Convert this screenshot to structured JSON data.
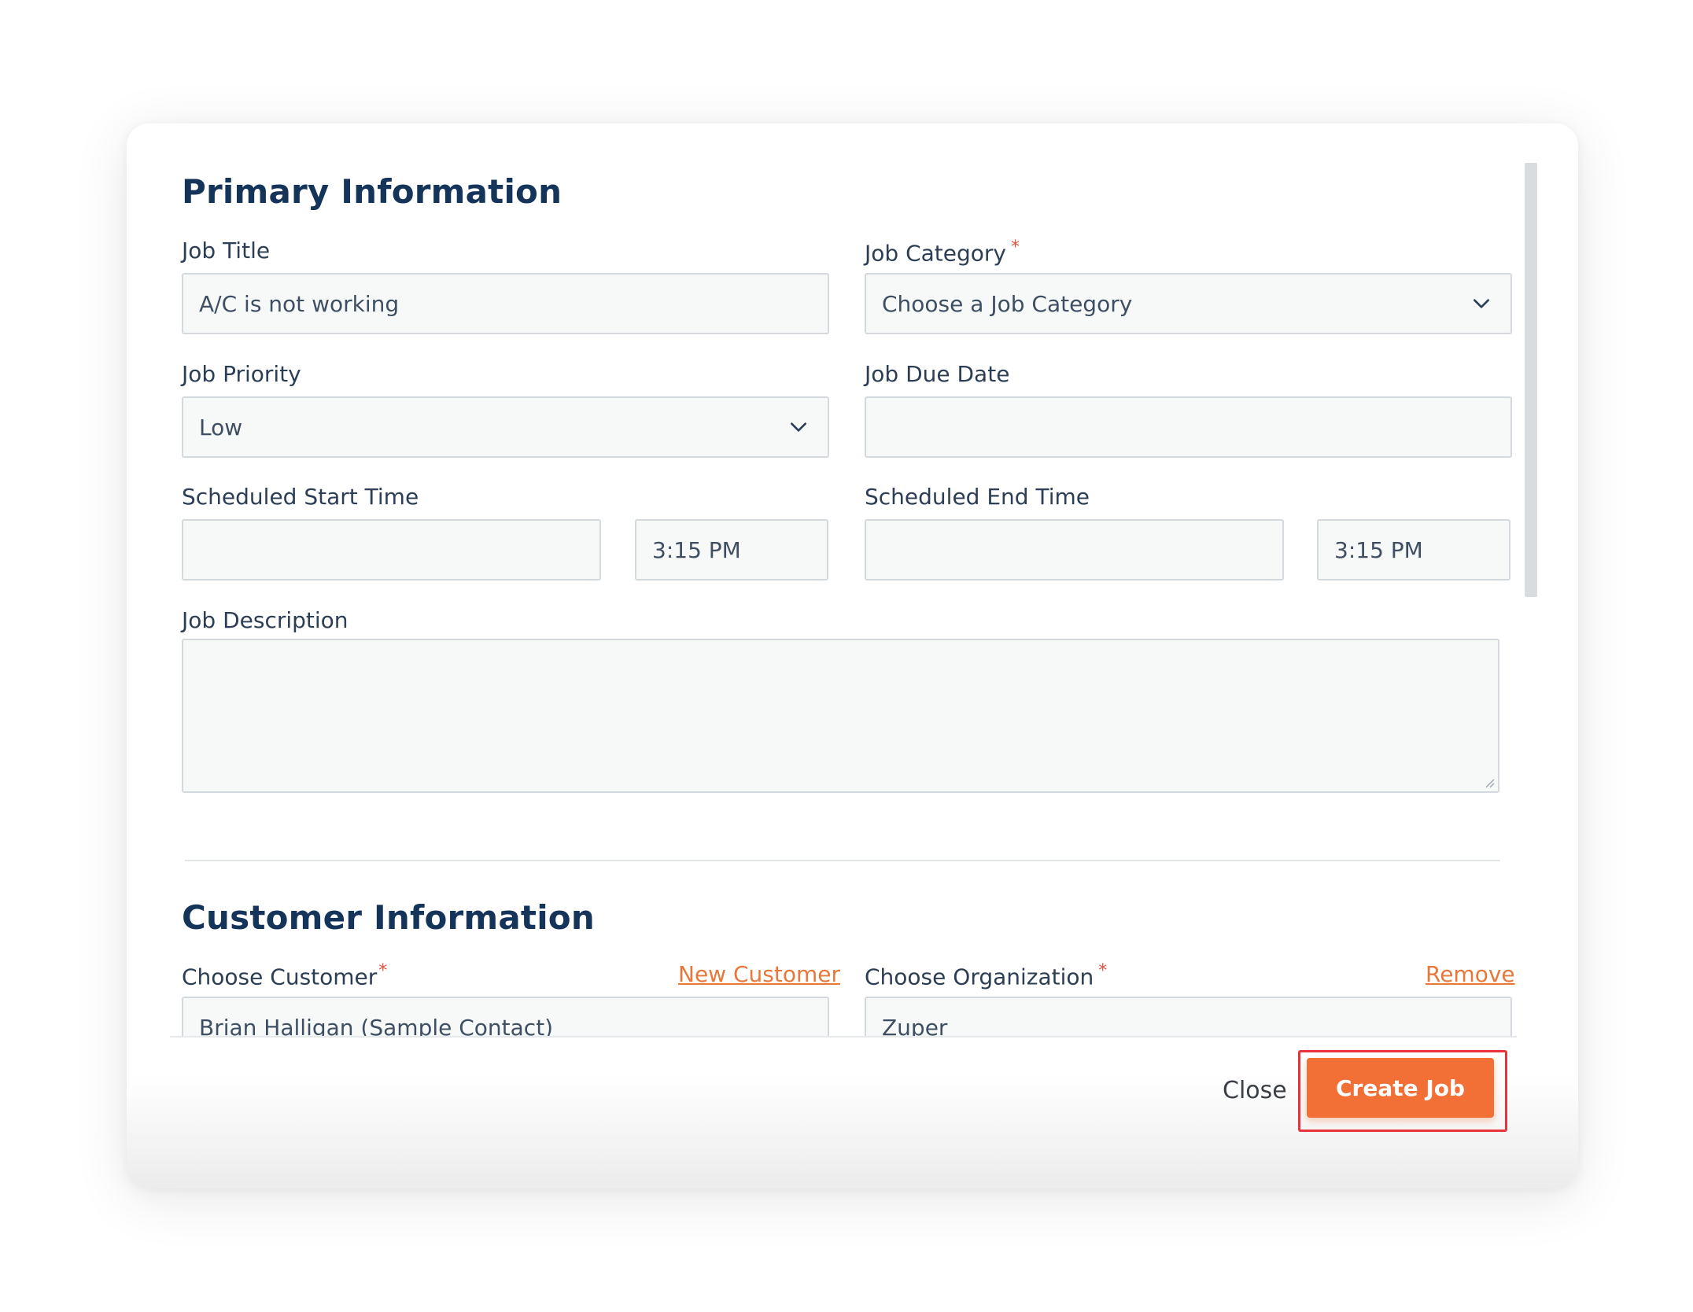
{
  "primary": {
    "title": "Primary Information",
    "job_title": {
      "label": "Job Title",
      "value": "A/C is not working"
    },
    "job_category": {
      "label": "Job Category",
      "required_mark": "*",
      "value": "Choose a Job Category",
      "icon": "chevron-down-icon"
    },
    "job_priority": {
      "label": "Job Priority",
      "value": "Low",
      "icon": "chevron-down-icon"
    },
    "job_due_date": {
      "label": "Job Due Date",
      "value": ""
    },
    "scheduled_start": {
      "label": "Scheduled Start Time",
      "date": "",
      "time": "3:15 PM"
    },
    "scheduled_end": {
      "label": "Scheduled End Time",
      "date": "",
      "time": "3:15 PM"
    },
    "job_description": {
      "label": "Job Description",
      "value": ""
    }
  },
  "customer": {
    "title": "Customer Information",
    "choose_customer": {
      "label": "Choose Customer",
      "required_mark": "*",
      "link": "New Customer",
      "value": "Brian Halligan (Sample Contact)"
    },
    "choose_organization": {
      "label": "Choose Organization",
      "required_mark": "*",
      "link": "Remove",
      "value": "Zuper"
    }
  },
  "footer": {
    "close_label": "Close",
    "create_label": "Create Job"
  },
  "colors": {
    "heading": "#14345a",
    "accent": "#f26f35",
    "link": "#e8783a",
    "required": "#e8503a",
    "highlight": "#e8333a"
  }
}
